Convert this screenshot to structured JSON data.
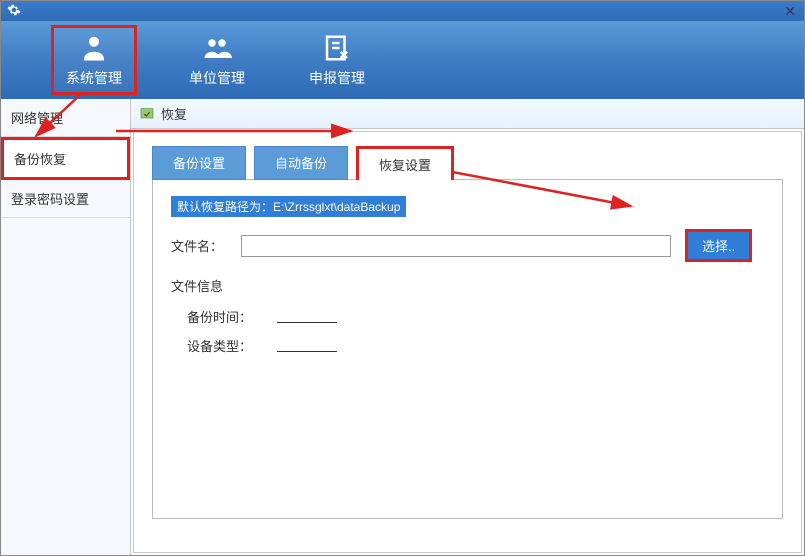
{
  "ribbon": {
    "items": [
      {
        "label": "系统管理",
        "icon": "user-admin"
      },
      {
        "label": "单位管理",
        "icon": "group"
      },
      {
        "label": "申报管理",
        "icon": "document-edit"
      }
    ]
  },
  "sidebar": {
    "items": [
      {
        "label": "网络管理"
      },
      {
        "label": "备份恢复"
      },
      {
        "label": "登录密码设置"
      }
    ]
  },
  "toolbar": {
    "label": "恢复"
  },
  "tabs": [
    {
      "label": "备份设置"
    },
    {
      "label": "自动备份"
    },
    {
      "label": "恢复设置"
    }
  ],
  "panel": {
    "default_path_text": "默认恢复路径为：E:\\Zrrssglxt\\dataBackup",
    "filename_label": "文件名：",
    "filename_value": "",
    "select_button": "选择..",
    "file_info_title": "文件信息",
    "backup_time_label": "备份时间：",
    "backup_time_value": "",
    "device_type_label": "设备类型：",
    "device_type_value": ""
  },
  "colors": {
    "highlight": "#d22",
    "primary": "#2f7ed8"
  }
}
